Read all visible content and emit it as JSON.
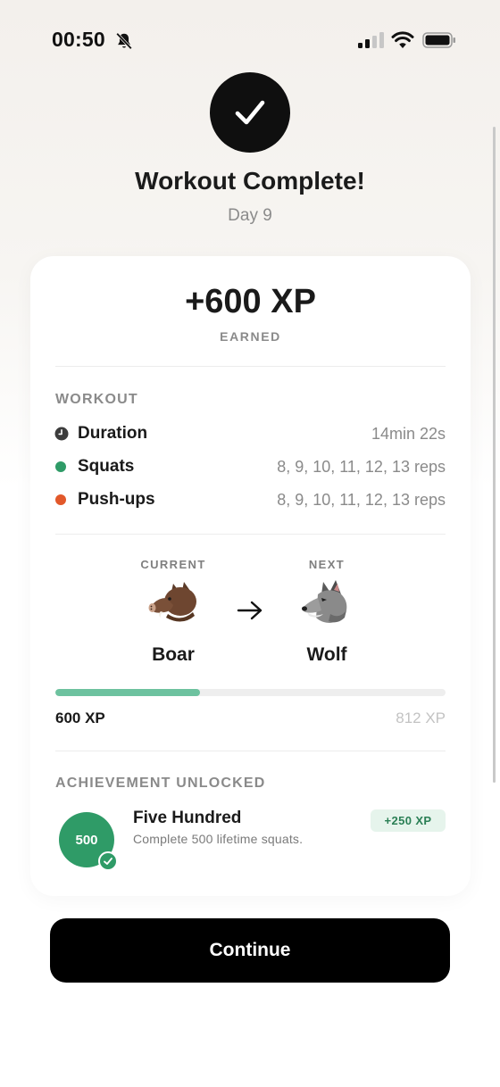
{
  "status_bar": {
    "time": "00:50",
    "icons": [
      "bell-slash-icon",
      "signal-icon",
      "wifi-icon",
      "battery-icon"
    ]
  },
  "header": {
    "icon": "checkmark-icon",
    "title": "Workout Complete!",
    "subtitle": "Day 9"
  },
  "xp_summary": {
    "value": "+600 XP",
    "label": "EARNED"
  },
  "workout": {
    "section_title": "WORKOUT",
    "rows": [
      {
        "label": "Duration",
        "value": "14min 22s",
        "icon": "clock-icon"
      },
      {
        "label": "Squats",
        "value": "8, 9, 10, 11, 12, 13 reps",
        "color": "#2f9b67"
      },
      {
        "label": "Push-ups",
        "value": "8, 9, 10, 11, 12, 13 reps",
        "color": "#e2582a"
      }
    ]
  },
  "evolution": {
    "current_caption": "CURRENT",
    "current_name": "Boar",
    "current_icon": "boar-icon",
    "next_caption": "NEXT",
    "next_name": "Wolf",
    "next_icon": "wolf-icon",
    "arrow_icon": "arrow-right-icon"
  },
  "progress": {
    "current_label": "600 XP",
    "target_label": "812 XP",
    "fraction": 0.37,
    "color": "#6dc29f"
  },
  "achievement": {
    "section_title": "ACHIEVEMENT UNLOCKED",
    "badge_text": "500",
    "title": "Five Hundred",
    "description": "Complete 500 lifetime squats.",
    "reward": "+250 XP",
    "color": "#2f9b67"
  },
  "continue_button": {
    "label": "Continue"
  }
}
